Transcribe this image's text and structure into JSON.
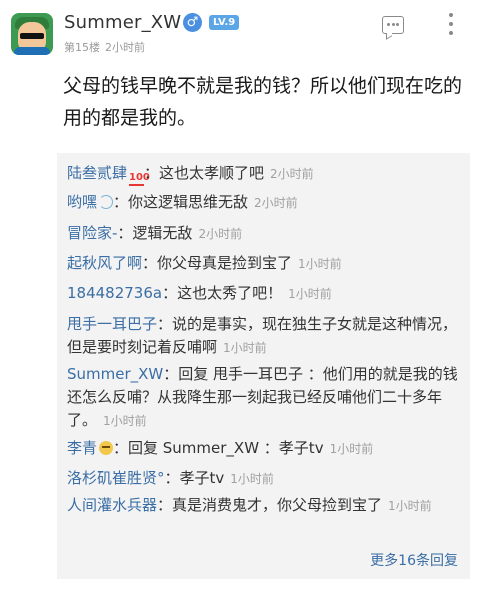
{
  "post": {
    "username": "Summer_XW",
    "gender_symbol": "♂",
    "level": "LV.9",
    "floor": "第15楼",
    "time": "2小时前",
    "content": "父母的钱早晚不就是我的钱？所以他们现在吃的用的都是我的。"
  },
  "comments": [
    {
      "name": "陆叁贰肆",
      "icon": "hundred-points-icon",
      "text": "：这也太孝顺了吧",
      "time": "2小时前"
    },
    {
      "name": "哟嘿",
      "icon": "swirl-icon",
      "text": "：你这逻辑思维无敌",
      "time": "2小时前"
    },
    {
      "name": "冒险家-",
      "text": "：逻辑无敌",
      "time": "2小时前"
    },
    {
      "name": "起秋风了啊",
      "text": "：你父母真是捡到宝了",
      "time": "1小时前"
    },
    {
      "name": "184482736a",
      "text": "：这也太秀了吧！",
      "time": "1小时前"
    },
    {
      "name": "甩手一耳巴子",
      "text": "：说的是事实，现在独生子女就是这种情况，但是要时刻记着反哺啊",
      "time": "1小时前"
    },
    {
      "name": "Summer_XW",
      "text": "：回复 甩手一耳巴子 ：他们用的就是我的钱还怎么反哺？从我降生那一刻起我已经反哺他们二十多年了。",
      "time": "1小时前"
    },
    {
      "name": "李青",
      "icon": "face-icon",
      "text": "：回复 Summer_XW ：孝子tv",
      "time": "1小时前"
    },
    {
      "name": "洛杉矶崔胜贤°",
      "text": "：孝子tv",
      "time": "1小时前"
    },
    {
      "name": "人间灌水兵器",
      "text": "：真是消费鬼才，你父母捡到宝了",
      "time": "1小时前"
    }
  ],
  "more_replies": "更多16条回复",
  "colors": {
    "name_link": "#3a6ea5",
    "comment_bg": "#f3f3f3",
    "level_badge": "#5aa6e6",
    "gender_badge": "#4a8fe0"
  }
}
